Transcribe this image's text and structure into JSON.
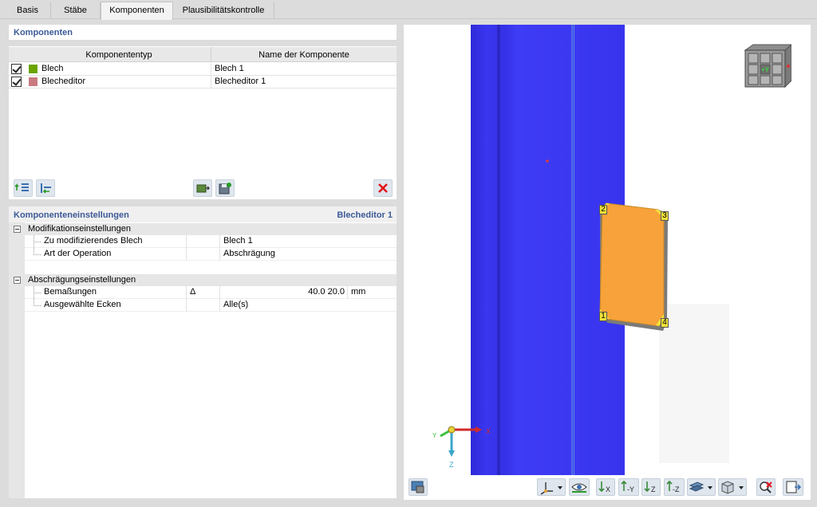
{
  "tabs": [
    {
      "label": "Basis",
      "active": false
    },
    {
      "label": "Stäbe",
      "active": false
    },
    {
      "label": "Komponenten",
      "active": true
    },
    {
      "label": "Plausibilitätskontrolle",
      "active": false
    }
  ],
  "components": {
    "title": "Komponenten",
    "columns": [
      "Komponententyp",
      "Name der Komponente"
    ],
    "rows": [
      {
        "checked": true,
        "type": "Blech",
        "color": "#6aa400",
        "name": "Blech 1"
      },
      {
        "checked": true,
        "type": "Blecheditor",
        "color": "#c97a80",
        "name": "Blecheditor 1"
      }
    ]
  },
  "settings": {
    "title": "Komponenteneinstellungen",
    "current": "Blecheditor 1",
    "groups": [
      {
        "label": "Modifikationseinstellungen",
        "rows": [
          {
            "label": "Zu modifizierendes Blech",
            "symbol": "",
            "value": "Blech 1",
            "unit": ""
          },
          {
            "label": "Art der Operation",
            "symbol": "",
            "value": "Abschrägung",
            "unit": ""
          }
        ]
      },
      {
        "label": "Abschrägungseinstellungen",
        "rows": [
          {
            "label": "Bemaßungen",
            "symbol": "Δ",
            "value": "40.0 20.0",
            "unit": "mm"
          },
          {
            "label": "Ausgewählte Ecken",
            "symbol": "",
            "value": "Alle(s)",
            "unit": ""
          }
        ]
      }
    ]
  },
  "viewport": {
    "beam_color": "#3a36f0",
    "plate_color": "#f7a23a",
    "corner_labels": [
      "1",
      "2",
      "3",
      "4"
    ],
    "view_cube_label": "+Y",
    "axis_labels": {
      "x": "X",
      "y": "Y",
      "z": "Z"
    },
    "toolbar_icons": [
      "axes-icon",
      "view-icon",
      "view-x-icon",
      "view-minus-y-icon",
      "view-z-icon",
      "view-minus-z-icon",
      "display-mode-icon",
      "box-view-icon",
      "zoom-reset-icon",
      "export-icon"
    ]
  }
}
